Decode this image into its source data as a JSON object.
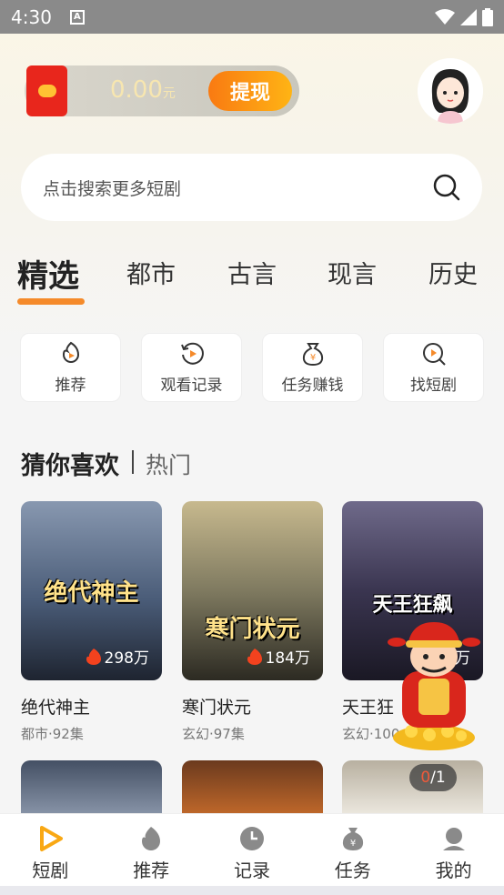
{
  "status_bar": {
    "time": "4:30"
  },
  "wallet": {
    "amount": "0.00",
    "unit": "元",
    "withdraw_label": "提现"
  },
  "search": {
    "placeholder": "点击搜索更多短剧"
  },
  "category_tabs": [
    {
      "label": "精选",
      "active": true
    },
    {
      "label": "都市"
    },
    {
      "label": "古言"
    },
    {
      "label": "现言"
    },
    {
      "label": "历史"
    }
  ],
  "quick_actions": [
    {
      "label": "推荐",
      "icon": "flame-play-icon"
    },
    {
      "label": "观看记录",
      "icon": "history-play-icon"
    },
    {
      "label": "任务赚钱",
      "icon": "money-bag-icon"
    },
    {
      "label": "找短剧",
      "icon": "search-play-icon"
    }
  ],
  "section": {
    "title": "猜你喜欢",
    "subtitle": "热门"
  },
  "dramas": [
    {
      "poster_title": "绝代神主",
      "heat": "298万",
      "name": "绝代神主",
      "meta": "都市·92集",
      "color": "#5b6f8a"
    },
    {
      "poster_title": "寒门状元",
      "heat": "184万",
      "name": "寒门状元",
      "meta": "玄幻·97集",
      "color": "#6b6250"
    },
    {
      "poster_title": "天王狂飙",
      "heat": "万",
      "name": "天王狂",
      "meta": "玄幻·100",
      "color": "#3b3550"
    }
  ],
  "second_row_counter": {
    "current": "0",
    "total": "/1"
  },
  "bottom_nav": [
    {
      "label": "短剧",
      "icon": "play-icon",
      "active": true
    },
    {
      "label": "推荐",
      "icon": "flame-icon"
    },
    {
      "label": "记录",
      "icon": "clock-icon"
    },
    {
      "label": "任务",
      "icon": "money-bag-icon"
    },
    {
      "label": "我的",
      "icon": "user-icon"
    }
  ],
  "colors": {
    "accent": "#f58a2a",
    "brand_orange": "#f98f12",
    "red": "#e8261c"
  }
}
